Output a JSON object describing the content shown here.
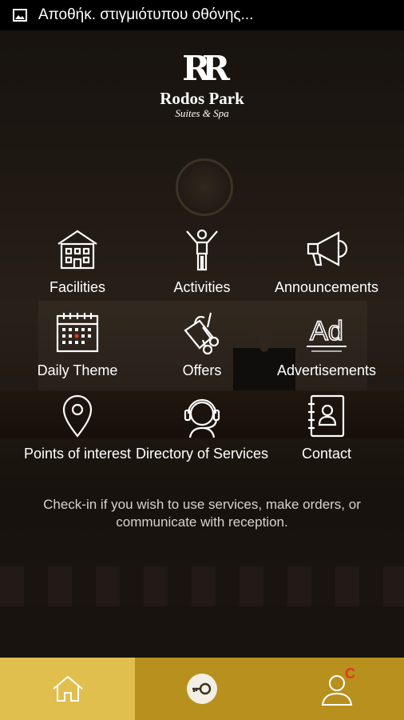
{
  "status_bar": {
    "icon": "image-icon",
    "text": "Αποθήκ. στιγμιότυπου οθόνης..."
  },
  "logo": {
    "mark": "RR",
    "name": "Rodos Park",
    "subtitle": "Suites & Spa"
  },
  "menu": [
    {
      "label": "Facilities",
      "icon": "hotel-building-icon"
    },
    {
      "label": "Activities",
      "icon": "person-activity-icon"
    },
    {
      "label": "Announcements",
      "icon": "megaphone-icon"
    },
    {
      "label": "Daily Theme",
      "icon": "calendar-icon"
    },
    {
      "label": "Offers",
      "icon": "shopping-bag-icon"
    },
    {
      "label": "Advertisements",
      "icon": "ad-icon"
    },
    {
      "label": "Points of interest",
      "icon": "map-pin-icon"
    },
    {
      "label": "Directory of Services",
      "icon": "headset-agent-icon"
    },
    {
      "label": "Contact",
      "icon": "contact-book-icon"
    }
  ],
  "notice": "Check-in if you wish to use services, make orders, or communicate with reception.",
  "bottom_bar": {
    "tabs": [
      {
        "name": "home",
        "icon": "home-icon",
        "active": true
      },
      {
        "name": "check-in",
        "icon": "key-icon"
      },
      {
        "name": "profile",
        "icon": "user-icon",
        "badge": "C"
      }
    ]
  },
  "colors": {
    "bottom_bar": "#b8901d",
    "active_tab": "#e0bf4f",
    "badge": "#e8361d"
  }
}
